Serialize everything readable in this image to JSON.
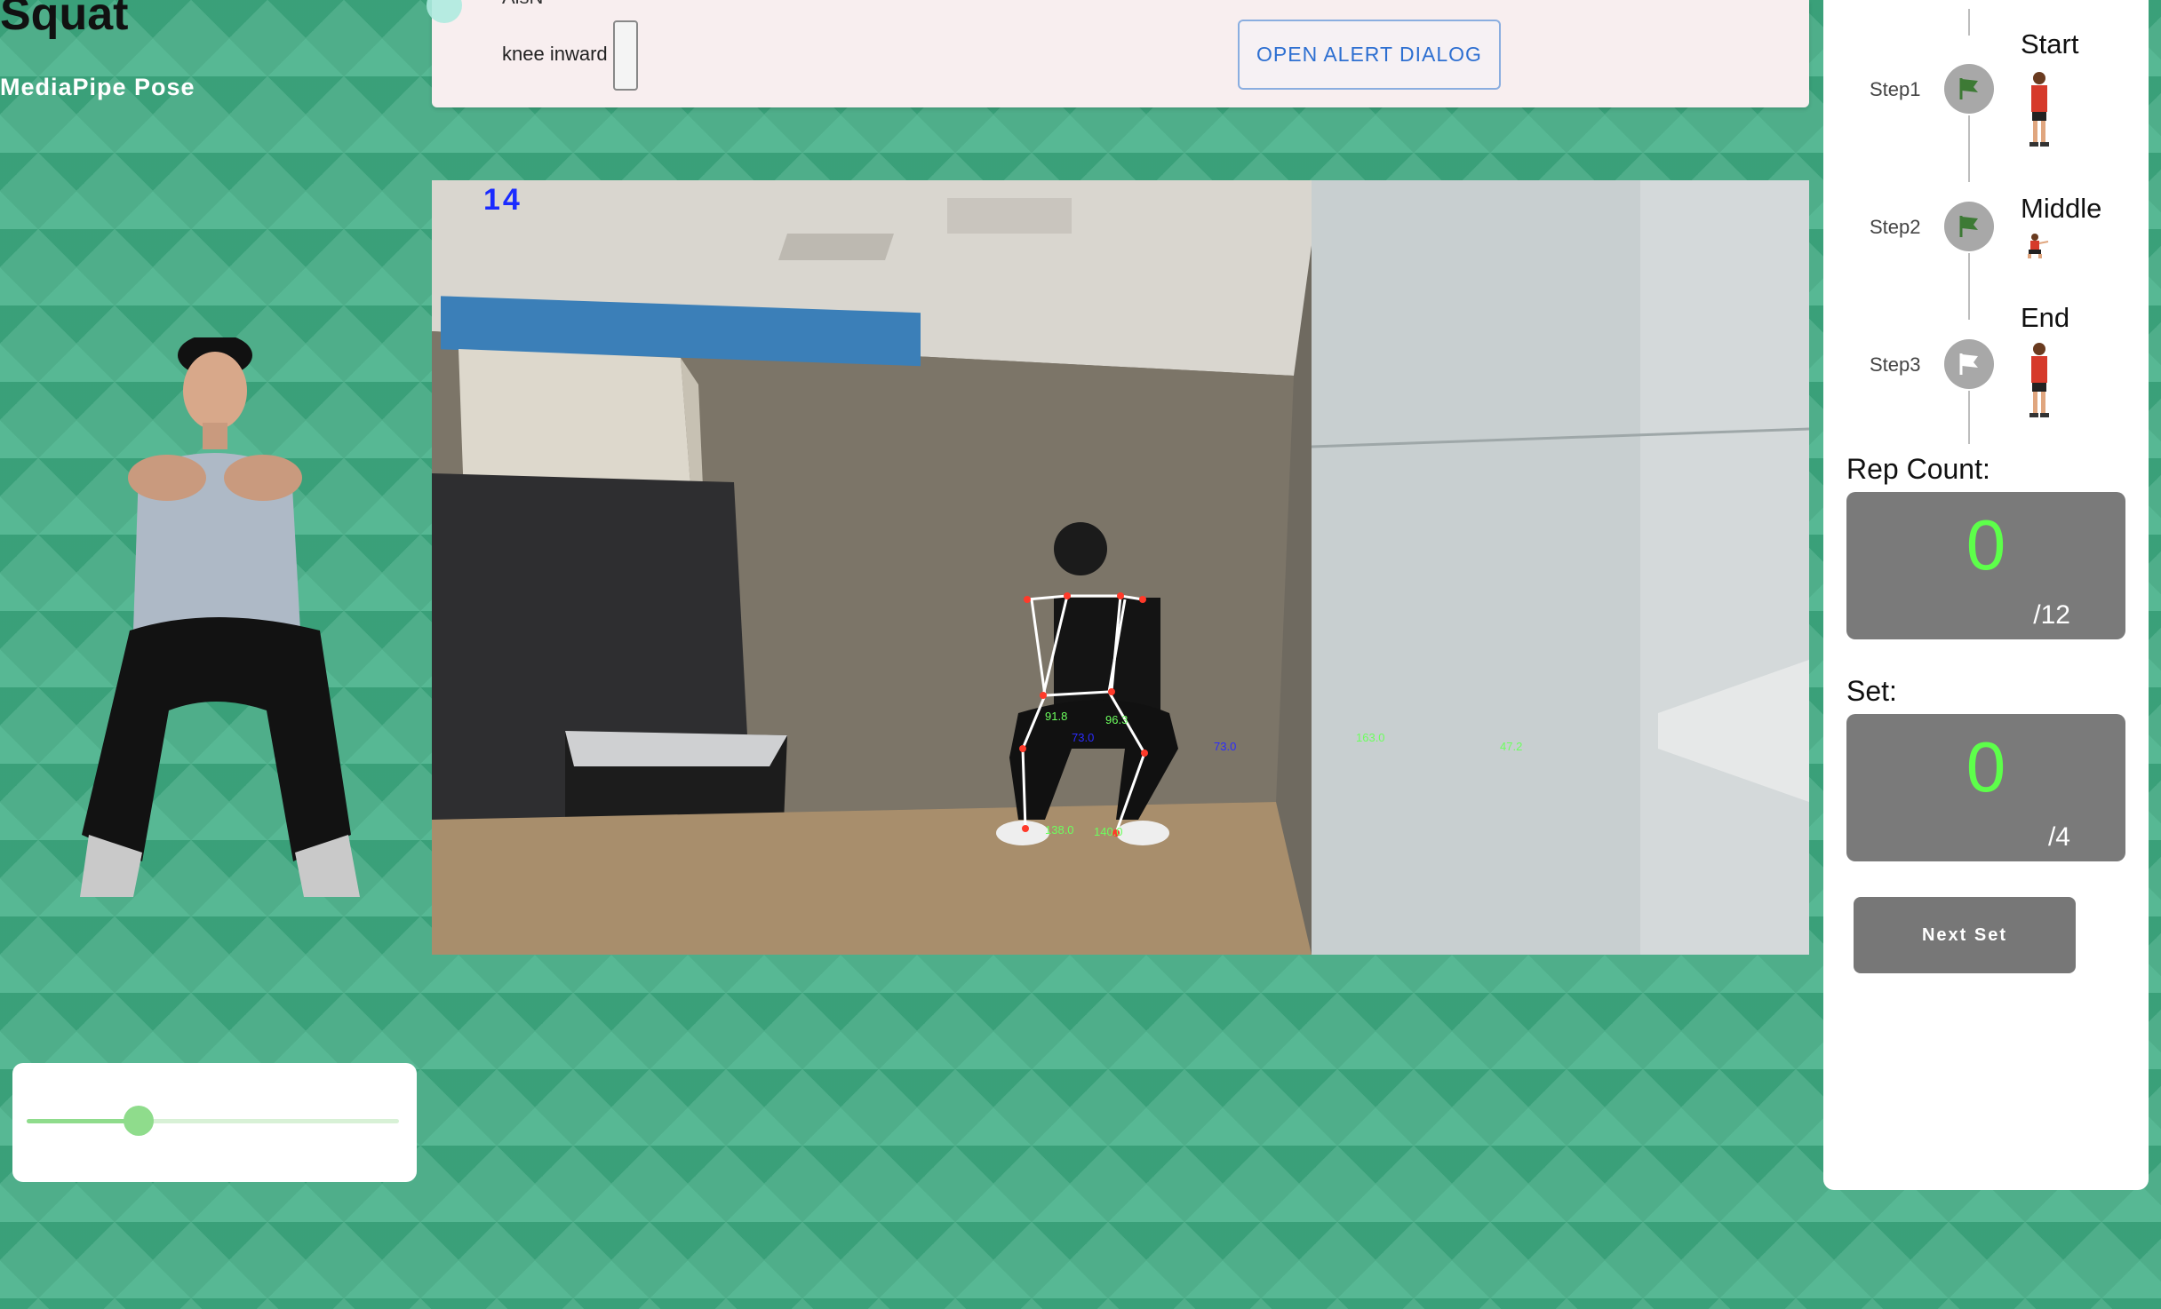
{
  "header": {
    "title": "Squat",
    "subtitle": "MediaPipe Pose"
  },
  "slider": {
    "value_fraction": 0.3
  },
  "alert_bar": {
    "top_text": "AlsN",
    "knee_label": "knee inward",
    "button_label": "OPEN ALERT DIALOG"
  },
  "camera": {
    "frame_counter": "14",
    "angle_readouts": [
      "91.8",
      "96.3",
      "73.0",
      "73.0",
      "138.0",
      "140.0",
      "163.0",
      "47.2"
    ]
  },
  "steps": [
    {
      "label": "Step1",
      "title": "Start",
      "flag": "flag-icon-green"
    },
    {
      "label": "Step2",
      "title": "Middle",
      "flag": "flag-icon-green"
    },
    {
      "label": "Step3",
      "title": "End",
      "flag": "flag-icon-white"
    }
  ],
  "rep_count": {
    "heading": "Rep Count:",
    "value": "0",
    "total": "/12"
  },
  "set_count": {
    "heading": "Set:",
    "value": "0",
    "total": "/4"
  },
  "next_set_label": "Next Set",
  "colors": {
    "background": "#4fae8a",
    "counter_value": "#5dff4a",
    "alert_button_text": "#2d6fd1",
    "flag_active": "#3d7a35"
  }
}
